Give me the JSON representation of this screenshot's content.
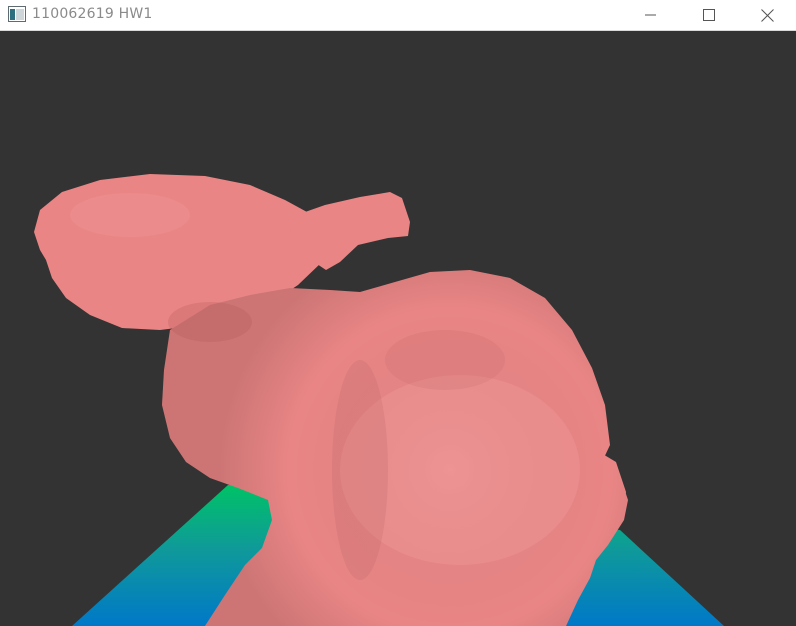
{
  "window": {
    "title": "110062619 HW1"
  },
  "icons": {
    "app": "app-window-icon",
    "minimize": "minimize-icon",
    "maximize": "maximize-icon",
    "close": "close-icon"
  },
  "scene": {
    "background_color": "#333333",
    "model_color": "#e98585",
    "floor_colors": [
      "#00c266",
      "#0f9a99",
      "#0078c8"
    ]
  }
}
